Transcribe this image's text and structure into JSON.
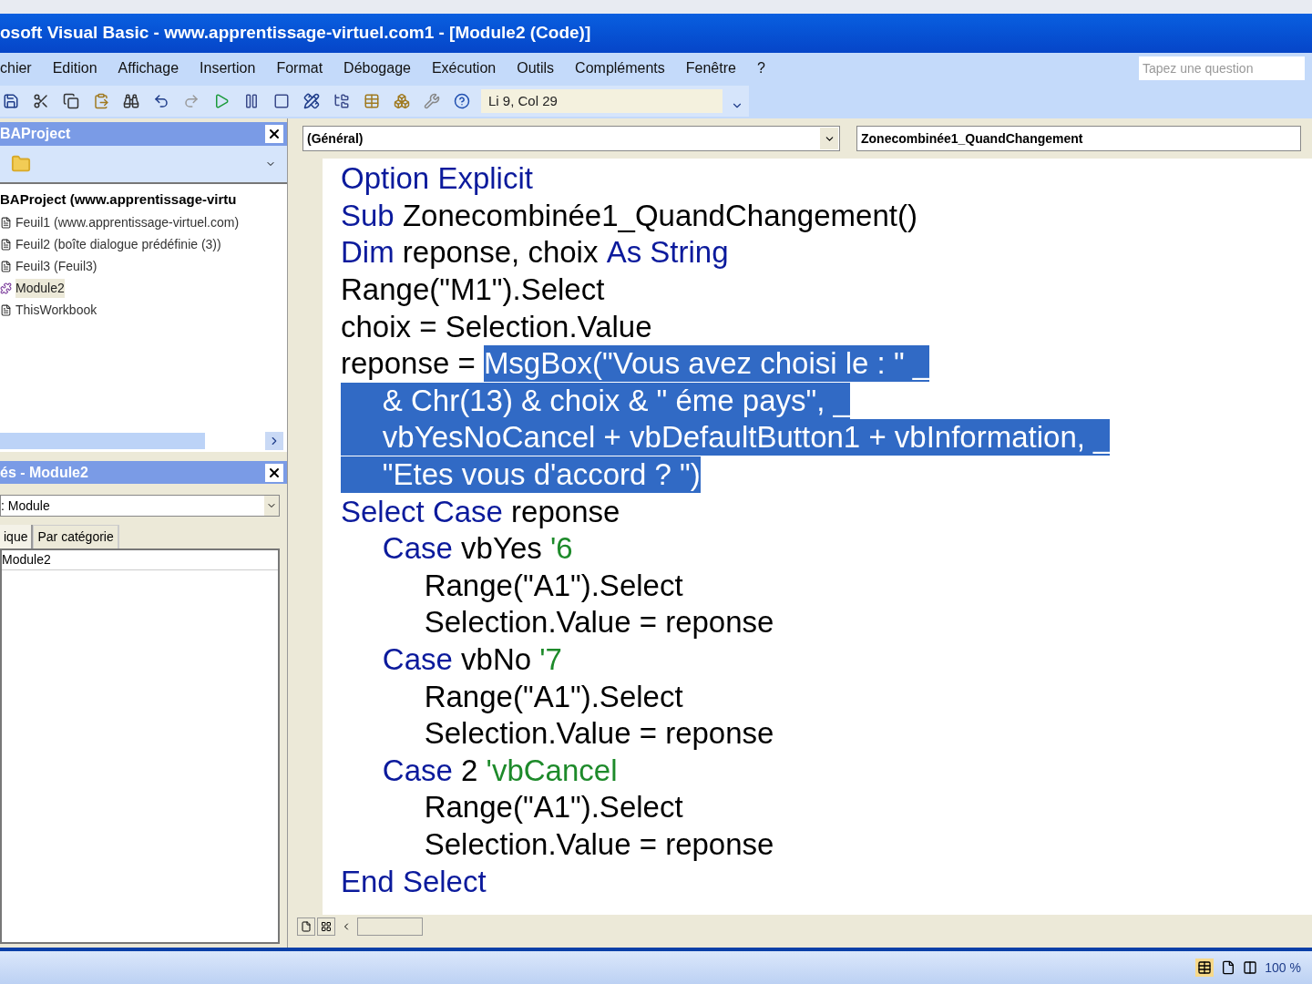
{
  "window": {
    "title": "osoft Visual Basic - www.apprentissage-virtuel.com1 - [Module2 (Code)]"
  },
  "menu": [
    "chier",
    "Edition",
    "Affichage",
    "Insertion",
    "Format",
    "Débogage",
    "Exécution",
    "Outils",
    "Compléments",
    "Fenêtre",
    "?"
  ],
  "help_search": {
    "placeholder": "Tapez une question"
  },
  "toolbar": {
    "position": "Li 9, Col 29"
  },
  "project_explorer": {
    "title": "BAProject",
    "root": "BAProject (www.apprentissage-virtu",
    "items": [
      {
        "label": "Feuil1 (www.apprentissage-virtuel.com)",
        "kind": "sheet",
        "selected": false
      },
      {
        "label": "Feuil2 (boîte  dialogue prédéfinie (3))",
        "kind": "sheet",
        "selected": false
      },
      {
        "label": "Feuil3 (Feuil3)",
        "kind": "sheet",
        "selected": false
      },
      {
        "label": "Module2",
        "kind": "module",
        "selected": true
      },
      {
        "label": "ThisWorkbook",
        "kind": "sheet",
        "selected": false
      }
    ]
  },
  "properties": {
    "title": "és - Module2",
    "object": ": Module",
    "tabs": [
      {
        "label": "ique",
        "selected": true
      },
      {
        "label": "Par catégorie",
        "selected": false
      }
    ],
    "rows": [
      "Module2"
    ]
  },
  "code_window": {
    "object": "(Général)",
    "procedure": "Zonecombinée1_QuandChangement",
    "lines": [
      [
        {
          "text": "Option Explicit",
          "kind": "keyword",
          "selected": false
        }
      ],
      [
        {
          "text": "Sub",
          "kind": "keyword",
          "selected": false
        },
        {
          "text": " Zonecombinée1_QuandChangement()",
          "kind": "plain",
          "selected": false
        }
      ],
      [
        {
          "text": "Dim",
          "kind": "keyword",
          "selected": false
        },
        {
          "text": " reponse, choix ",
          "kind": "plain",
          "selected": false
        },
        {
          "text": "As String",
          "kind": "keyword",
          "selected": false
        }
      ],
      [
        {
          "text": "Range(\"M1\").Select",
          "kind": "plain",
          "selected": false
        }
      ],
      [
        {
          "text": "choix = Selection.Value",
          "kind": "plain",
          "selected": false
        }
      ],
      [
        {
          "text": "reponse = ",
          "kind": "plain",
          "selected": false
        },
        {
          "text": "MsgBox(\"Vous avez choisi le : \" _",
          "selected": true
        }
      ],
      [
        {
          "text": "     & Chr(13) & choix & \" éme pays\", _",
          "selected": true
        }
      ],
      [
        {
          "text": "     vbYesNoCancel + vbDefaultButton1 + vbInformation, _",
          "selected": true
        }
      ],
      [
        {
          "text": "     \"Etes vous d'accord ? \")",
          "selected": true
        }
      ],
      [
        {
          "text": "Select Case",
          "kind": "keyword",
          "selected": false
        },
        {
          "text": " reponse",
          "kind": "plain",
          "selected": false
        }
      ],
      [
        {
          "text": "     Case",
          "kind": "keyword",
          "selected": false
        },
        {
          "text": " vbYes ",
          "kind": "plain",
          "selected": false
        },
        {
          "text": "'6",
          "kind": "comment",
          "selected": false
        }
      ],
      [
        {
          "text": "          Range(\"A1\").Select",
          "kind": "plain",
          "selected": false
        }
      ],
      [
        {
          "text": "          Selection.Value = reponse",
          "kind": "plain",
          "selected": false
        }
      ],
      [
        {
          "text": "     Case",
          "kind": "keyword",
          "selected": false
        },
        {
          "text": " vbNo ",
          "kind": "plain",
          "selected": false
        },
        {
          "text": "'7",
          "kind": "comment",
          "selected": false
        }
      ],
      [
        {
          "text": "          Range(\"A1\").Select",
          "kind": "plain",
          "selected": false
        }
      ],
      [
        {
          "text": "          Selection.Value = reponse",
          "kind": "plain",
          "selected": false
        }
      ],
      [
        {
          "text": "     Case",
          "kind": "keyword",
          "selected": false
        },
        {
          "text": " 2 ",
          "kind": "plain",
          "selected": false
        },
        {
          "text": "'vbCancel",
          "kind": "comment",
          "selected": false
        }
      ],
      [
        {
          "text": "          Range(\"A1\").Select",
          "kind": "plain",
          "selected": false
        }
      ],
      [
        {
          "text": "          Selection.Value = reponse",
          "kind": "plain",
          "selected": false
        }
      ],
      [
        {
          "text": "End Select",
          "kind": "keyword",
          "selected": false
        }
      ]
    ]
  },
  "status_bar": {
    "zoom": "100 %"
  }
}
